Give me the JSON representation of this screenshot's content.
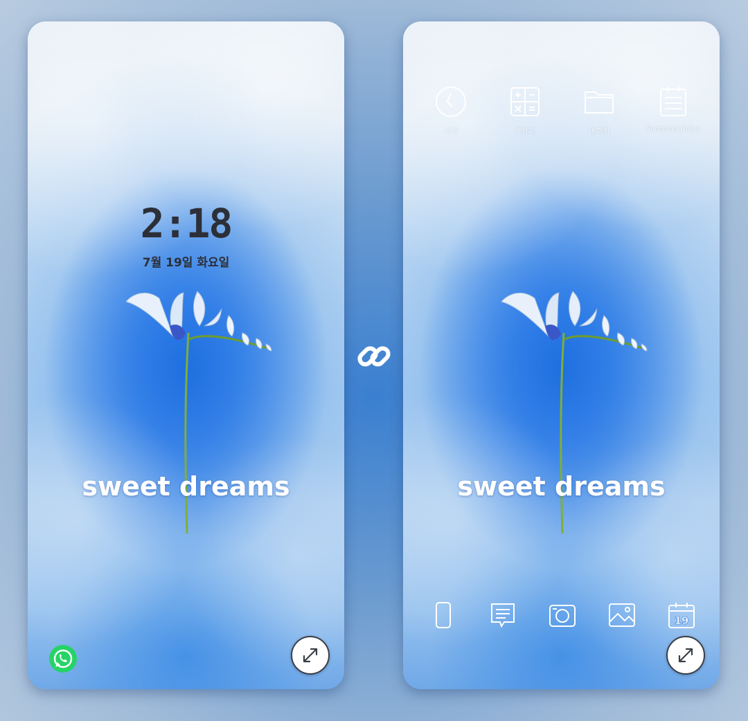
{
  "lock_screen": {
    "time": "2:18",
    "date": "7월 19일 화요일",
    "wallpaper_text": "sweet dreams"
  },
  "home_screen": {
    "wallpaper_text": "sweet dreams",
    "apps_top": [
      {
        "label": "시계",
        "icon": "clock-icon"
      },
      {
        "label": "계산기",
        "icon": "calculator-icon"
      },
      {
        "label": "내 파일",
        "icon": "folder-icon"
      },
      {
        "label": "Samsung Notes",
        "icon": "notes-icon"
      }
    ],
    "dock": [
      {
        "icon": "phone-icon"
      },
      {
        "icon": "messages-icon"
      },
      {
        "icon": "camera-icon"
      },
      {
        "icon": "gallery-icon"
      },
      {
        "icon": "calendar-icon",
        "text": "19"
      }
    ]
  },
  "colors": {
    "accent": "#2a76e0",
    "whatsapp": "#25d366"
  }
}
